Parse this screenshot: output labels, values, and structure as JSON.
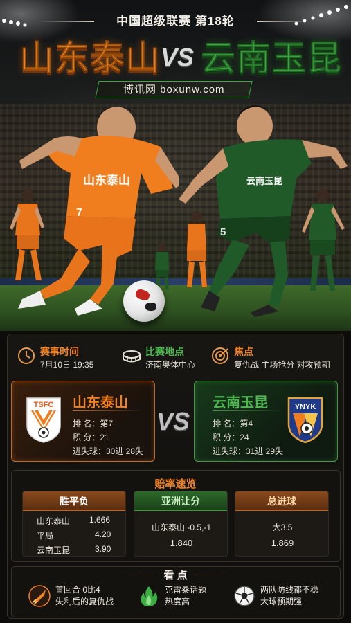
{
  "header": {
    "league": "中国超级联赛 第18轮",
    "home_team": "山东泰山",
    "vs": "VS",
    "away_team": "云南玉昆",
    "site": "博讯网 boxunw.com"
  },
  "hero": {
    "home_jersey_text": "山东泰山",
    "home_number": "7",
    "away_jersey_text": "云南玉昆",
    "away_number": "5"
  },
  "info": {
    "time_title": "赛事时间",
    "time_value": "7月10日 19:35",
    "venue_title": "比赛地点",
    "venue_value": "济南奥体中心",
    "focus_title": "焦点",
    "focus_value": "复仇战  主场抢分  对攻预期"
  },
  "home_card": {
    "crest": "TSFC",
    "name": "山东泰山",
    "rank": "排 名：第7",
    "points": "积 分：21",
    "goals": "进失球：30进 28失"
  },
  "away_card": {
    "crest": "YNYK",
    "name": "云南玉昆",
    "rank": "排 名：第4",
    "points": "积 分：24",
    "goals": "进失球：31进 29失"
  },
  "middle_vs": "VS",
  "odds": {
    "title": "赔率速览",
    "wdl": {
      "header": "胜平负",
      "rows": [
        {
          "label": "山东泰山",
          "value": "1.666"
        },
        {
          "label": "平局",
          "value": "4.20"
        },
        {
          "label": "云南玉昆",
          "value": "3.90"
        }
      ]
    },
    "asian": {
      "header": "亚洲让分",
      "line": "山东泰山 -0.5,-1",
      "value": "1.840"
    },
    "total": {
      "header": "总进球",
      "line": "大3.5",
      "value": "1.869"
    }
  },
  "key_points": {
    "title": "看 点",
    "items": [
      {
        "icon": "rocket-icon",
        "line1": "首回合 0比4",
        "line2": "失利后的复仇战"
      },
      {
        "icon": "flame-icon",
        "line1": "克雷桑话题",
        "line2": "热度高"
      },
      {
        "icon": "soccer-ball-icon",
        "line1": "两队防线都不稳",
        "line2": "大球预期强"
      }
    ]
  },
  "colors": {
    "home_accent": "#f08224",
    "away_accent": "#4cb84f",
    "panel_bg": "#14120f"
  }
}
